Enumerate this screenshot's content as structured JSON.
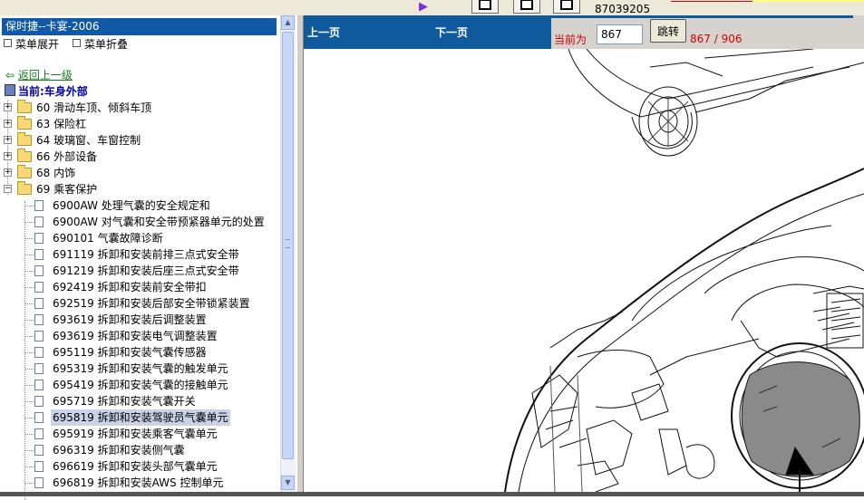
{
  "top_strip": {
    "arrow_icon": "right-triangle-icon",
    "partial_text": "87039205",
    "button_icons": [
      "collapse-icon",
      "expand-icon",
      "back-icon"
    ]
  },
  "left_panel": {
    "title": "保时捷--卡宴-2006",
    "expand_menu": "菜单展开",
    "collapse_menu": "菜单折叠",
    "back_link": "返回上一级",
    "current": "当前:车身外部",
    "folders": [
      {
        "label": "60 滑动车顶、倾斜车顶",
        "expanded": false
      },
      {
        "label": "63 保险杠",
        "expanded": false
      },
      {
        "label": "64 玻璃窗、车窗控制",
        "expanded": false
      },
      {
        "label": "66 外部设备",
        "expanded": false
      },
      {
        "label": "68 内饰",
        "expanded": false
      },
      {
        "label": "69 乘客保护",
        "expanded": true
      }
    ],
    "documents": [
      "6900AW 处理气囊的安全规定和",
      "6900AW 对气囊和安全带预紧器单元的处置",
      "690101 气囊故障诊断",
      "691119 拆卸和安装前排三点式安全带",
      "691219 拆卸和安装后座三点式安全带",
      "692419 拆卸和安装前安全带扣",
      "692519 拆卸和安装后部安全带锁紧装置",
      "693619 拆卸和安装后调整装置",
      "693619 拆卸和安装电气调整装置",
      "695119 拆卸和安装气囊传感器",
      "695319 拆卸和安装气囊的触发单元",
      "695419 拆卸和安装气囊的接触单元",
      "695719 拆卸和安装气囊开关",
      "695819 拆卸和安装驾驶员气囊单元",
      "695919 拆卸和安装乘客气囊单元",
      "696319 拆卸和安装侧气囊",
      "696619 拆卸和安装头部气囊单元",
      "696819 拆卸和安装AWS 控制单元"
    ],
    "selected_document_index": 13
  },
  "viewer": {
    "prev_page": "上一页",
    "next_page": "下一页",
    "current_label": "当前为",
    "page_input": "867",
    "jump_button": "跳转",
    "page_count": "867 / 906"
  },
  "colors": {
    "title_bar": "#0f59a7",
    "nav_bar": "#0f5a9c",
    "page_text": "#d00000",
    "selection": "#c8d3e6"
  }
}
